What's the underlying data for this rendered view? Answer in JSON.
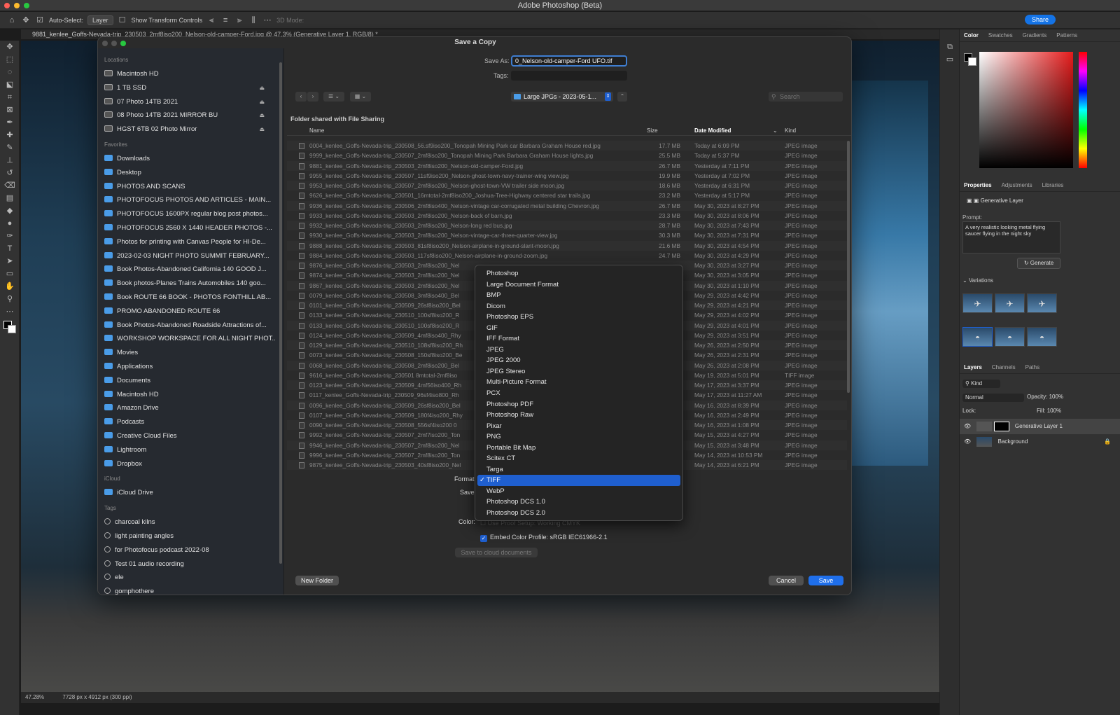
{
  "app": {
    "title": "Adobe Photoshop (Beta)",
    "share_label": "Share"
  },
  "options_bar": {
    "auto_select_label": "Auto-Select:",
    "layer_select": "Layer",
    "transform_label": "Show Transform Controls",
    "mode_3d": "3D Mode:"
  },
  "document_tab": {
    "title": "9881_kenlee_Goffs-Nevada-trip_230503_2mf8iso200_Nelson-old-camper-Ford.jpg @ 47.3% (Generative Layer 1, RGB/8) *"
  },
  "status": {
    "zoom": "47.28%",
    "doc_info": "7728 px x 4912 px (300 ppi)"
  },
  "dialog": {
    "title": "Save a Copy",
    "save_as_label": "Save As:",
    "save_as_value": "0_Nelson-old-camper-Ford UFO.tif",
    "tags_label": "Tags:",
    "location": "Large JPGs - 2023-05-1...",
    "search_placeholder": "Search",
    "shared_note": "Folder shared with File Sharing",
    "columns": {
      "name": "Name",
      "size": "Size",
      "date": "Date Modified",
      "kind": "Kind"
    },
    "files": [
      {
        "name": "0004_kenlee_Goffs-Nevada-trip_230508_56.sf9iso200_Tonopah Mining Park car Barbara Graham House red.jpg",
        "size": "17.7 MB",
        "date": "Today at 6:09 PM",
        "kind": "JPEG image"
      },
      {
        "name": "9999_kenlee_Goffs-Nevada-trip_230507_2mf8iso200_Tonopah Mining Park Barbara Graham House lights.jpg",
        "size": "25.5 MB",
        "date": "Today at 5:37 PM",
        "kind": "JPEG image"
      },
      {
        "name": "9881_kenlee_Goffs-Nevada-trip_230503_2mf8iso200_Nelson-old-camper-Ford.jpg",
        "size": "26.7 MB",
        "date": "Yesterday at 7:11 PM",
        "kind": "JPEG image"
      },
      {
        "name": "9955_kenlee_Goffs-Nevada-trip_230507_11sf9iso200_Nelson-ghost-town-navy-trainer-wing view.jpg",
        "size": "19.9 MB",
        "date": "Yesterday at 7:02 PM",
        "kind": "JPEG image"
      },
      {
        "name": "9953_kenlee_Goffs-Nevada-trip_230507_2mf8iso200_Nelson-ghost-town-VW trailer side moon.jpg",
        "size": "18.6 MB",
        "date": "Yesterday at 6:31 PM",
        "kind": "JPEG image"
      },
      {
        "name": "9626_kenlee_Goffs-Nevada-trip_230501_16mtotal-2mf8iso200_Joshua-Tree-Highway centered star trails.jpg",
        "size": "23.2 MB",
        "date": "Yesterday at 5:17 PM",
        "kind": "JPEG image"
      },
      {
        "name": "9936_kenlee_Goffs-Nevada-trip_230506_2mf8iso400_Nelson-vintage car-corrugated metal building Chevron.jpg",
        "size": "26.7 MB",
        "date": "May 30, 2023 at 8:27 PM",
        "kind": "JPEG image"
      },
      {
        "name": "9933_kenlee_Goffs-Nevada-trip_230503_2mf8iso200_Nelson-back of barn.jpg",
        "size": "23.3 MB",
        "date": "May 30, 2023 at 8:06 PM",
        "kind": "JPEG image"
      },
      {
        "name": "9932_kenlee_Goffs-Nevada-trip_230503_2mf8iso200_Nelson-long red bus.jpg",
        "size": "28.7 MB",
        "date": "May 30, 2023 at 7:43 PM",
        "kind": "JPEG image"
      },
      {
        "name": "9930_kenlee_Goffs-Nevada-trip_230503_2mf8iso200_Nelson-vintage-car-three-quarter-view.jpg",
        "size": "30.3 MB",
        "date": "May 30, 2023 at 7:31 PM",
        "kind": "JPEG image"
      },
      {
        "name": "9888_kenlee_Goffs-Nevada-trip_230503_81sf8iso200_Nelson-airplane-in-ground-slant-moon.jpg",
        "size": "21.6 MB",
        "date": "May 30, 2023 at 4:54 PM",
        "kind": "JPEG image"
      },
      {
        "name": "9884_kenlee_Goffs-Nevada-trip_230503_117sf8iso200_Nelson-airplane-in-ground-zoom.jpg",
        "size": "24.7 MB",
        "date": "May 30, 2023 at 4:29 PM",
        "kind": "JPEG image"
      },
      {
        "name": "9876_kenlee_Goffs-Nevada-trip_230503_2mf8iso200_Nel",
        "size": "",
        "date": "May 30, 2023 at 3:27 PM",
        "kind": "JPEG image"
      },
      {
        "name": "9874_kenlee_Goffs-Nevada-trip_230503_2mf8iso200_Nel",
        "size": "",
        "date": "May 30, 2023 at 3:05 PM",
        "kind": "JPEG image"
      },
      {
        "name": "9867_kenlee_Goffs-Nevada-trip_230503_2mf8iso200_Nel",
        "size": "",
        "date": "May 30, 2023 at 1:10 PM",
        "kind": "JPEG image"
      },
      {
        "name": "0079_kenlee_Goffs-Nevada-trip_230508_3mf8iso400_Bel",
        "size": "",
        "date": "May 29, 2023 at 4:42 PM",
        "kind": "JPEG image"
      },
      {
        "name": "0101_kenlee_Goffs-Nevada-trip_230509_26sf8iso200_Bel",
        "size": "",
        "date": "May 29, 2023 at 4:21 PM",
        "kind": "JPEG image"
      },
      {
        "name": "0133_kenlee_Goffs-Nevada-trip_230510_100sf8iso200_R",
        "size": "",
        "date": "May 29, 2023 at 4:02 PM",
        "kind": "JPEG image"
      },
      {
        "name": "0133_kenlee_Goffs-Nevada-trip_230510_100sf8iso200_R",
        "size": "",
        "date": "May 29, 2023 at 4:01 PM",
        "kind": "JPEG image"
      },
      {
        "name": "0124_kenlee_Goffs-Nevada-trip_230509_4mf8iso400_Rhy",
        "size": "",
        "date": "May 29, 2023 at 3:51 PM",
        "kind": "JPEG image"
      },
      {
        "name": "0129_kenlee_Goffs-Nevada-trip_230510_108sf8iso200_Rh",
        "size": "",
        "date": "May 26, 2023 at 2:50 PM",
        "kind": "JPEG image"
      },
      {
        "name": "0073_kenlee_Goffs-Nevada-trip_230508_150sf8iso200_Be",
        "size": "",
        "date": "May 26, 2023 at 2:31 PM",
        "kind": "JPEG image"
      },
      {
        "name": "0068_kenlee_Goffs-Nevada-trip_230508_2mf8iso200_Bel",
        "size": "",
        "date": "May 26, 2023 at 2:08 PM",
        "kind": "JPEG image"
      },
      {
        "name": "9616_kenlee_Goffs-Nevada-trip_230501 8mtotal-2mf8iso",
        "size": "",
        "date": "May 19, 2023 at 5:01 PM",
        "kind": "TIFF image"
      },
      {
        "name": "0123_kenlee_Goffs-Nevada-trip_230509_4mf56iso400_Rh",
        "size": "",
        "date": "May 17, 2023 at 3:37 PM",
        "kind": "JPEG image"
      },
      {
        "name": "0117_kenlee_Goffs-Nevada-trip_230509_96sf4iso800_Rh",
        "size": "",
        "date": "May 17, 2023 at 11:27 AM",
        "kind": "JPEG image"
      },
      {
        "name": "0096_kenlee_Goffs-Nevada-trip_230509_26sf8iso200_Bel",
        "size": "",
        "date": "May 16, 2023 at 8:39 PM",
        "kind": "JPEG image"
      },
      {
        "name": "0107_kenlee_Goffs-Nevada-trip_230509_180f4iso200_Rhy",
        "size": "",
        "date": "May 16, 2023 at 2:49 PM",
        "kind": "JPEG image"
      },
      {
        "name": "0090_kenlee_Goffs-Nevada-trip_230508_556sf4iso200 0",
        "size": "",
        "date": "May 16, 2023 at 1:08 PM",
        "kind": "JPEG image"
      },
      {
        "name": "9992_kenlee_Goffs-Nevada-trip_230507_2mf7iso200_Ton",
        "size": "",
        "date": "May 15, 2023 at 4:27 PM",
        "kind": "JPEG image"
      },
      {
        "name": "9946_kenlee_Goffs-Nevada-trip_230507_2mf8iso200_Nel",
        "size": "",
        "date": "May 15, 2023 at 3:48 PM",
        "kind": "JPEG image"
      },
      {
        "name": "9996_kenlee_Goffs-Nevada-trip_230507_2mf8iso200_Ton",
        "size": "",
        "date": "May 14, 2023 at 10:53 PM",
        "kind": "JPEG image"
      },
      {
        "name": "9875_kenlee_Goffs-Nevada-trip_230503_40sf8iso200_Nel",
        "size": "",
        "date": "May 14, 2023 at 6:21 PM",
        "kind": "JPEG image"
      }
    ],
    "format_label": "Format",
    "save_label": "Save",
    "color_label": "Color:",
    "proof_setup": "Use Proof Setup:  Working CMYK",
    "embed_profile": "Embed Color Profile:  sRGB IEC61966-2.1",
    "cloud_button": "Save to cloud documents",
    "new_folder": "New Folder",
    "cancel": "Cancel",
    "save": "Save",
    "formats": [
      "Photoshop",
      "Large Document Format",
      "BMP",
      "Dicom",
      "Photoshop EPS",
      "GIF",
      "IFF Format",
      "JPEG",
      "JPEG 2000",
      "JPEG Stereo",
      "Multi-Picture Format",
      "PCX",
      "Photoshop PDF",
      "Photoshop Raw",
      "Pixar",
      "PNG",
      "Portable Bit Map",
      "Scitex CT",
      "Targa",
      "TIFF",
      "WebP",
      "Photoshop DCS 1.0",
      "Photoshop DCS 2.0"
    ],
    "selected_format": "TIFF"
  },
  "sidebar": {
    "locations_label": "Locations",
    "locations": [
      "Macintosh HD",
      "1 TB SSD",
      "07 Photo 14TB 2021",
      "08 Photo 14TB 2021 MIRROR BU",
      "HGST 6TB 02 Photo Mirror"
    ],
    "favorites_label": "Favorites",
    "favorites": [
      "Downloads",
      "Desktop",
      "PHOTOS AND SCANS",
      "PHOTOFOCUS PHOTOS AND ARTICLES - MAIN...",
      "PHOTOFOCUS 1600PX regular blog post photos...",
      "PHOTOFOCUS 2560 X 1440 HEADER PHOTOS -...",
      "Photos for printing with Canvas People for HI-De...",
      "2023-02-03 NIGHT PHOTO SUMMIT FEBRUARY...",
      "Book Photos-Abandoned California 140 GOOD J...",
      "Book photos-Planes Trains Automobiles 140 goo...",
      "Book ROUTE 66 BOOK - PHOTOS FONTHILL AB...",
      "PROMO ABANDONED ROUTE 66",
      "Book Photos-Abandoned Roadside Attractions of...",
      "WORKSHOP WORKSPACE FOR ALL NIGHT PHOT...",
      "Movies",
      "Applications",
      "Documents",
      "Macintosh HD",
      "Amazon Drive",
      "Podcasts",
      "Creative Cloud Files",
      "Lightroom",
      "Dropbox"
    ],
    "icloud_label": "iCloud",
    "icloud": [
      "iCloud Drive"
    ],
    "tags_label": "Tags",
    "tags": [
      "charcoal kilns",
      "light painting angles",
      "for Photofocus podcast 2022-08",
      "Test 01 audio recording",
      "ele",
      "gomphothere"
    ]
  },
  "panels": {
    "color_tabs": [
      "Color",
      "Swatches",
      "Gradients",
      "Patterns"
    ],
    "prop_tabs": [
      "Properties",
      "Adjustments",
      "Libraries"
    ],
    "generative_layer": "Generative Layer",
    "prompt_label": "Prompt:",
    "prompt_text": "A very realistic looking metal flying saucer flying in the night sky",
    "generate": "Generate",
    "variations": "Variations",
    "layer_tabs": [
      "Layers",
      "Channels",
      "Paths"
    ],
    "kind": "Kind",
    "blend": "Normal",
    "opacity_label": "Opacity:",
    "opacity": "100%",
    "lock_label": "Lock:",
    "fill_label": "Fill:",
    "fill": "100%",
    "layers": [
      "Generative Layer 1",
      "Background"
    ]
  }
}
